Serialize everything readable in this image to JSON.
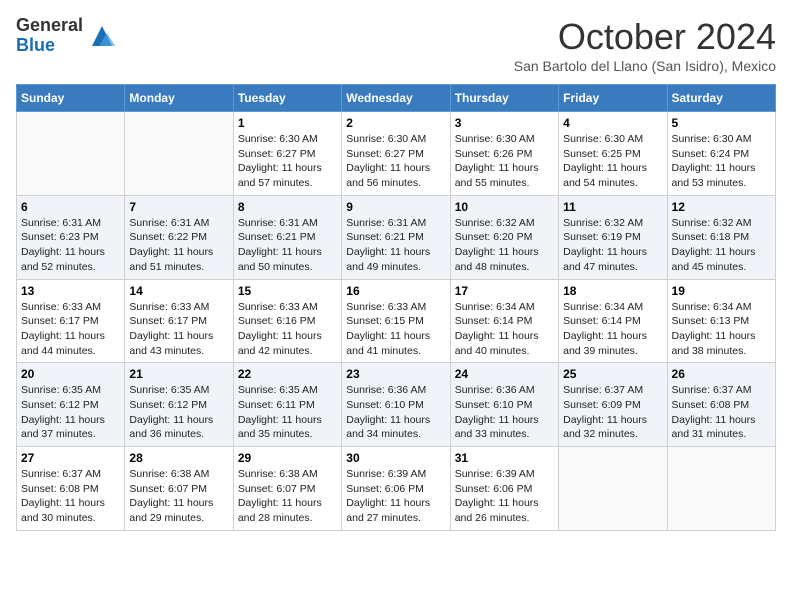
{
  "logo": {
    "general": "General",
    "blue": "Blue"
  },
  "title": "October 2024",
  "location": "San Bartolo del Llano (San Isidro), Mexico",
  "days_header": [
    "Sunday",
    "Monday",
    "Tuesday",
    "Wednesday",
    "Thursday",
    "Friday",
    "Saturday"
  ],
  "weeks": [
    [
      {
        "day": "",
        "info": ""
      },
      {
        "day": "",
        "info": ""
      },
      {
        "day": "1",
        "info": "Sunrise: 6:30 AM\nSunset: 6:27 PM\nDaylight: 11 hours and 57 minutes."
      },
      {
        "day": "2",
        "info": "Sunrise: 6:30 AM\nSunset: 6:27 PM\nDaylight: 11 hours and 56 minutes."
      },
      {
        "day": "3",
        "info": "Sunrise: 6:30 AM\nSunset: 6:26 PM\nDaylight: 11 hours and 55 minutes."
      },
      {
        "day": "4",
        "info": "Sunrise: 6:30 AM\nSunset: 6:25 PM\nDaylight: 11 hours and 54 minutes."
      },
      {
        "day": "5",
        "info": "Sunrise: 6:30 AM\nSunset: 6:24 PM\nDaylight: 11 hours and 53 minutes."
      }
    ],
    [
      {
        "day": "6",
        "info": "Sunrise: 6:31 AM\nSunset: 6:23 PM\nDaylight: 11 hours and 52 minutes."
      },
      {
        "day": "7",
        "info": "Sunrise: 6:31 AM\nSunset: 6:22 PM\nDaylight: 11 hours and 51 minutes."
      },
      {
        "day": "8",
        "info": "Sunrise: 6:31 AM\nSunset: 6:21 PM\nDaylight: 11 hours and 50 minutes."
      },
      {
        "day": "9",
        "info": "Sunrise: 6:31 AM\nSunset: 6:21 PM\nDaylight: 11 hours and 49 minutes."
      },
      {
        "day": "10",
        "info": "Sunrise: 6:32 AM\nSunset: 6:20 PM\nDaylight: 11 hours and 48 minutes."
      },
      {
        "day": "11",
        "info": "Sunrise: 6:32 AM\nSunset: 6:19 PM\nDaylight: 11 hours and 47 minutes."
      },
      {
        "day": "12",
        "info": "Sunrise: 6:32 AM\nSunset: 6:18 PM\nDaylight: 11 hours and 45 minutes."
      }
    ],
    [
      {
        "day": "13",
        "info": "Sunrise: 6:33 AM\nSunset: 6:17 PM\nDaylight: 11 hours and 44 minutes."
      },
      {
        "day": "14",
        "info": "Sunrise: 6:33 AM\nSunset: 6:17 PM\nDaylight: 11 hours and 43 minutes."
      },
      {
        "day": "15",
        "info": "Sunrise: 6:33 AM\nSunset: 6:16 PM\nDaylight: 11 hours and 42 minutes."
      },
      {
        "day": "16",
        "info": "Sunrise: 6:33 AM\nSunset: 6:15 PM\nDaylight: 11 hours and 41 minutes."
      },
      {
        "day": "17",
        "info": "Sunrise: 6:34 AM\nSunset: 6:14 PM\nDaylight: 11 hours and 40 minutes."
      },
      {
        "day": "18",
        "info": "Sunrise: 6:34 AM\nSunset: 6:14 PM\nDaylight: 11 hours and 39 minutes."
      },
      {
        "day": "19",
        "info": "Sunrise: 6:34 AM\nSunset: 6:13 PM\nDaylight: 11 hours and 38 minutes."
      }
    ],
    [
      {
        "day": "20",
        "info": "Sunrise: 6:35 AM\nSunset: 6:12 PM\nDaylight: 11 hours and 37 minutes."
      },
      {
        "day": "21",
        "info": "Sunrise: 6:35 AM\nSunset: 6:12 PM\nDaylight: 11 hours and 36 minutes."
      },
      {
        "day": "22",
        "info": "Sunrise: 6:35 AM\nSunset: 6:11 PM\nDaylight: 11 hours and 35 minutes."
      },
      {
        "day": "23",
        "info": "Sunrise: 6:36 AM\nSunset: 6:10 PM\nDaylight: 11 hours and 34 minutes."
      },
      {
        "day": "24",
        "info": "Sunrise: 6:36 AM\nSunset: 6:10 PM\nDaylight: 11 hours and 33 minutes."
      },
      {
        "day": "25",
        "info": "Sunrise: 6:37 AM\nSunset: 6:09 PM\nDaylight: 11 hours and 32 minutes."
      },
      {
        "day": "26",
        "info": "Sunrise: 6:37 AM\nSunset: 6:08 PM\nDaylight: 11 hours and 31 minutes."
      }
    ],
    [
      {
        "day": "27",
        "info": "Sunrise: 6:37 AM\nSunset: 6:08 PM\nDaylight: 11 hours and 30 minutes."
      },
      {
        "day": "28",
        "info": "Sunrise: 6:38 AM\nSunset: 6:07 PM\nDaylight: 11 hours and 29 minutes."
      },
      {
        "day": "29",
        "info": "Sunrise: 6:38 AM\nSunset: 6:07 PM\nDaylight: 11 hours and 28 minutes."
      },
      {
        "day": "30",
        "info": "Sunrise: 6:39 AM\nSunset: 6:06 PM\nDaylight: 11 hours and 27 minutes."
      },
      {
        "day": "31",
        "info": "Sunrise: 6:39 AM\nSunset: 6:06 PM\nDaylight: 11 hours and 26 minutes."
      },
      {
        "day": "",
        "info": ""
      },
      {
        "day": "",
        "info": ""
      }
    ]
  ]
}
